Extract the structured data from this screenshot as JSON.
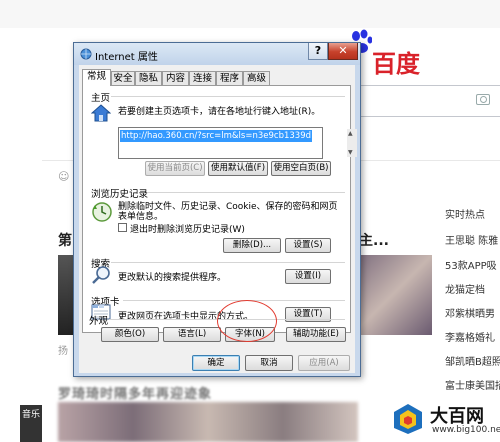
{
  "background": {
    "logo_text": "百度",
    "news_title_left": "第",
    "news_title_right": "唱主...",
    "caption": "扬",
    "hot_title": "实时热点",
    "hot_items": [
      "王思聪 陈雅",
      "53款APP吸",
      "龙猫定档",
      "邓紫棋晒男",
      "李嘉格婚礼",
      "邹凯晒B超照",
      "富士康美国招"
    ],
    "blur_title": "罗琦琦时隔多年再迎迹象",
    "music_tab": "音乐",
    "watermark_title": "大百网",
    "watermark_url": "www.big100.net"
  },
  "dialog": {
    "title": "Internet 属性",
    "help": "?",
    "close": "✕",
    "tabs": [
      "常规",
      "安全",
      "隐私",
      "内容",
      "连接",
      "程序",
      "高级"
    ],
    "active_tab": "常规",
    "homepage": {
      "label": "主页",
      "description": "若要创建主页选项卡，请在各地址行键入地址(R)。",
      "url": "http://hao.360.cn/?src=lm&ls=n3e9cb1339d",
      "buttons": [
        "使用当前页(C)",
        "使用默认值(F)",
        "使用空白页(B)"
      ]
    },
    "history": {
      "label": "浏览历史记录",
      "description_line1": "删除临时文件、历史记录、Cookie、保存的密码和网页",
      "description_line2": "表单信息。",
      "checkbox_label": "退出时删除浏览历史记录(W)",
      "delete_button": "删除(D)...",
      "settings_button": "设置(S)"
    },
    "search": {
      "label": "搜索",
      "description": "更改默认的搜索提供程序。",
      "settings_button": "设置(I)"
    },
    "tabs_group": {
      "label": "选项卡",
      "description": "更改网页在选项卡中显示的方式。",
      "settings_button": "设置(T)"
    },
    "appearance": {
      "label": "外观",
      "buttons": [
        "颜色(O)",
        "语言(L)",
        "字体(N)",
        "辅助功能(E)"
      ]
    },
    "footer": {
      "ok": "确定",
      "cancel": "取消",
      "apply": "应用(A)"
    }
  }
}
